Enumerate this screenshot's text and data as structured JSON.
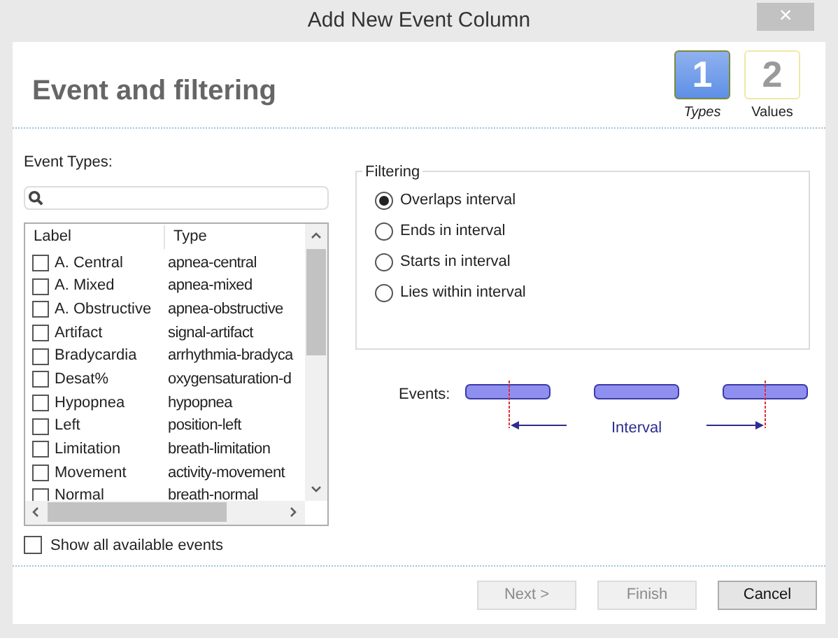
{
  "window": {
    "title": "Add New Event Column",
    "close": "×"
  },
  "header": {
    "title": "Event and filtering",
    "steps": [
      {
        "number": "1",
        "label": "Types",
        "selected": true
      },
      {
        "number": "2",
        "label": "Values",
        "selected": false
      }
    ]
  },
  "event_types": {
    "label": "Event Types:",
    "columns": [
      "Label",
      "Type"
    ],
    "rows": [
      {
        "label": "A. Central",
        "type": "apnea-central",
        "checked": false
      },
      {
        "label": "A. Mixed",
        "type": "apnea-mixed",
        "checked": false
      },
      {
        "label": "A. Obstructive",
        "type": "apnea-obstructive",
        "checked": false
      },
      {
        "label": "Artifact",
        "type": "signal-artifact",
        "checked": false
      },
      {
        "label": "Bradycardia",
        "type": "arrhythmia-bradyca",
        "checked": false
      },
      {
        "label": "Desat%",
        "type": "oxygensaturation-d",
        "checked": false
      },
      {
        "label": "Hypopnea",
        "type": "hypopnea",
        "checked": false
      },
      {
        "label": "Left",
        "type": "position-left",
        "checked": false
      },
      {
        "label": "Limitation",
        "type": "breath-limitation",
        "checked": false
      },
      {
        "label": "Movement",
        "type": "activity-movement",
        "checked": false
      },
      {
        "label": "Normal",
        "type": "breath-normal",
        "checked": false
      }
    ],
    "show_all": {
      "label": "Show all available events",
      "checked": false
    }
  },
  "filtering": {
    "title": "Filtering",
    "options": [
      {
        "label": "Overlaps interval",
        "selected": true
      },
      {
        "label": "Ends in interval",
        "selected": false
      },
      {
        "label": "Starts in interval",
        "selected": false
      },
      {
        "label": "Lies within interval",
        "selected": false
      }
    ]
  },
  "diagram": {
    "events_label": "Events:",
    "interval_label": "Interval"
  },
  "buttons": [
    {
      "label": "Next >",
      "disabled": true
    },
    {
      "label": "Finish",
      "disabled": true
    },
    {
      "label": "Cancel",
      "disabled": false
    }
  ]
}
